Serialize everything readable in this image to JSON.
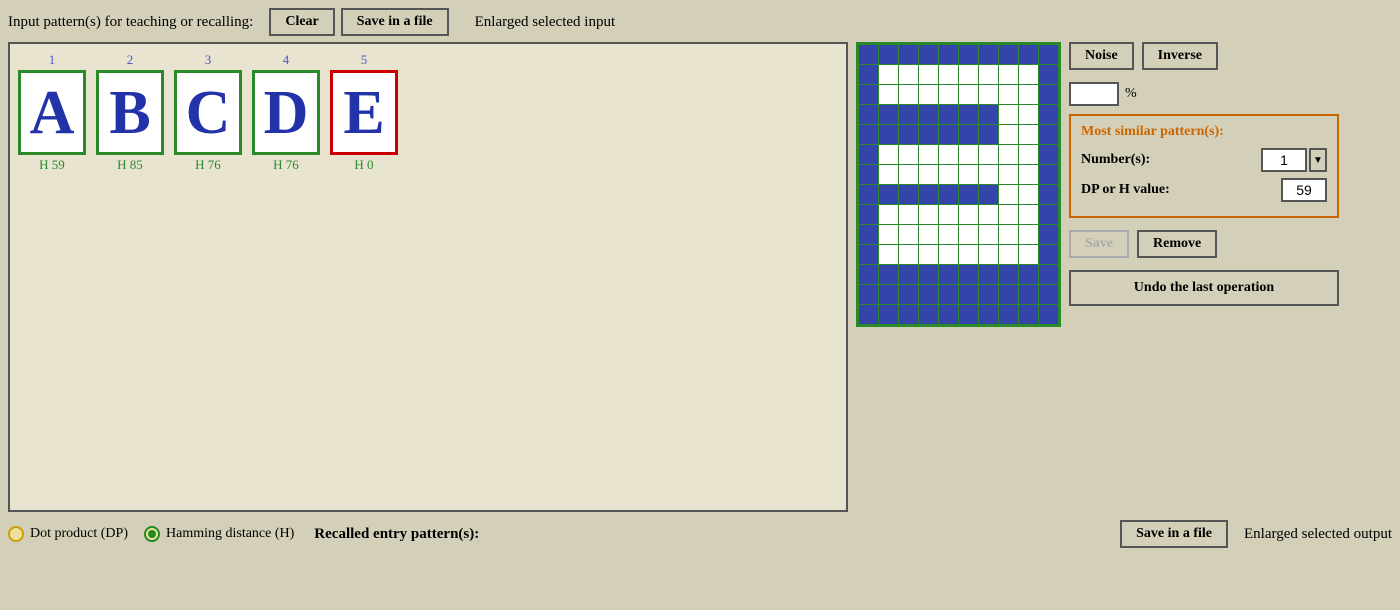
{
  "header": {
    "input_label": "Input pattern(s) for teaching or recalling:",
    "clear_button": "Clear",
    "save_button": "Save in a file",
    "enlarged_label": "Enlarged selected input"
  },
  "patterns": [
    {
      "number": "1",
      "letter": "A",
      "h_label": "H 59",
      "selected": false
    },
    {
      "number": "2",
      "letter": "B",
      "h_label": "H 85",
      "selected": false
    },
    {
      "number": "3",
      "letter": "C",
      "h_label": "H 76",
      "selected": false
    },
    {
      "number": "4",
      "letter": "D",
      "h_label": "H 76",
      "selected": false
    },
    {
      "number": "5",
      "letter": "E",
      "h_label": "H 0",
      "selected": true
    }
  ],
  "right_panel": {
    "noise_button": "Noise",
    "inverse_button": "Inverse",
    "percent_value": "",
    "percent_sign": "%",
    "most_similar_title": "Most similar pattern(s):",
    "numbers_label": "Number(s):",
    "numbers_value": "1",
    "dp_h_label": "DP or H value:",
    "dp_h_value": "59",
    "save_button": "Save",
    "remove_button": "Remove",
    "undo_button": "Undo the last operation"
  },
  "bottom": {
    "dp_label": "Dot product (DP)",
    "h_label": "Hamming distance (H)",
    "recalled_label": "Recalled entry pattern(s):",
    "save_output_button": "Save in a file",
    "enlarged_output_label": "Enlarged selected output"
  },
  "grid": {
    "rows": 14,
    "cols": 10,
    "cells": [
      [
        1,
        1,
        1,
        1,
        1,
        1,
        1,
        1,
        1,
        1
      ],
      [
        1,
        0,
        0,
        0,
        0,
        0,
        0,
        0,
        0,
        1
      ],
      [
        1,
        0,
        0,
        0,
        0,
        0,
        0,
        0,
        0,
        1
      ],
      [
        1,
        1,
        1,
        1,
        1,
        1,
        1,
        0,
        0,
        1
      ],
      [
        1,
        1,
        1,
        1,
        1,
        1,
        1,
        0,
        0,
        1
      ],
      [
        1,
        0,
        0,
        0,
        0,
        0,
        0,
        0,
        0,
        1
      ],
      [
        1,
        0,
        0,
        0,
        0,
        0,
        0,
        0,
        0,
        1
      ],
      [
        1,
        1,
        1,
        1,
        1,
        1,
        1,
        0,
        0,
        1
      ],
      [
        1,
        0,
        0,
        0,
        0,
        0,
        0,
        0,
        0,
        1
      ],
      [
        1,
        0,
        0,
        0,
        0,
        0,
        0,
        0,
        0,
        1
      ],
      [
        1,
        0,
        0,
        0,
        0,
        0,
        0,
        0,
        0,
        1
      ],
      [
        1,
        1,
        1,
        1,
        1,
        1,
        1,
        1,
        1,
        1
      ],
      [
        1,
        1,
        1,
        1,
        1,
        1,
        1,
        1,
        1,
        1
      ],
      [
        1,
        1,
        1,
        1,
        1,
        1,
        1,
        1,
        1,
        1
      ]
    ]
  }
}
